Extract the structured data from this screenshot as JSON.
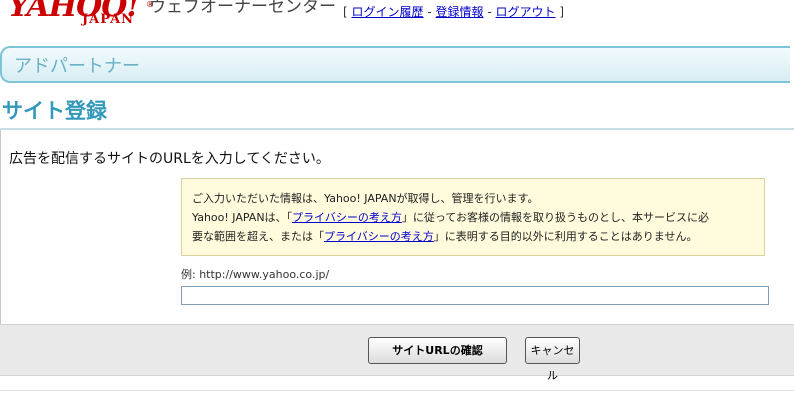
{
  "header": {
    "logo_main": "YAHOO!",
    "logo_sub": "JAPAN",
    "logo_reg": "®",
    "site_name": "ウェブオーナーセンター",
    "links": {
      "open": "[",
      "login_history": "ログイン履歴",
      "sep1": "-",
      "registration_info": "登録情報",
      "sep2": "-",
      "logout": "ログアウト",
      "close": "]"
    }
  },
  "band": {
    "title": "アドパートナー"
  },
  "page": {
    "title": "サイト登録",
    "instruction": "広告を配信するサイトのURLを入力してください。"
  },
  "notice": {
    "line1": "ご入力いただいた情報は、Yahoo! JAPANが取得し、管理を行います。",
    "line2_a": "Yahoo! JAPANは、「",
    "privacy_link_1": "プライバシーの考え方",
    "line2_b": "」に従ってお客様の情報を取り扱うものとし、本サービスに必",
    "line3_a": "要な範囲を超え、または「",
    "privacy_link_2": "プライバシーの考え方",
    "line3_b": "」に表明する目的以外に利用することはありません。"
  },
  "form": {
    "example": "例: http://www.yahoo.co.jp/",
    "url_value": ""
  },
  "buttons": {
    "confirm": "サイトURLの確認",
    "cancel": "キャンセル"
  }
}
